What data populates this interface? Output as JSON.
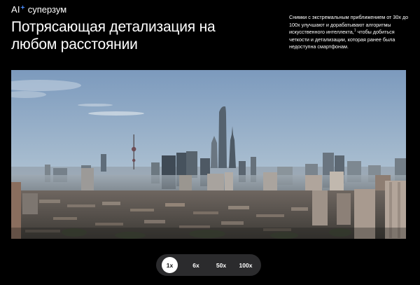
{
  "header": {
    "eyebrow_prefix": "AI",
    "eyebrow_suffix": "суперзум",
    "headline_line1": "Потрясающая детализация на",
    "headline_line2": "любом расстоянии",
    "blurb_part1": "Снимки с экстремальным приближением от 30x до 100x улучшают и дорабатывают алгоритмы искусственного интеллекта,",
    "blurb_footnote": "1",
    "blurb_part2": " чтобы добиться четкости и детализации, которая ранее была недоступна смартфонам."
  },
  "photo": {
    "sky_top": "#7f9dbf",
    "sky_bottom": "#cdd6dc"
  },
  "zoom": {
    "options": [
      "1x",
      "6x",
      "50x",
      "100x"
    ],
    "selected": "1x"
  },
  "colors": {
    "background": "#000000",
    "accent_star": "#4a8cff",
    "pill": "#2b2b2d"
  }
}
